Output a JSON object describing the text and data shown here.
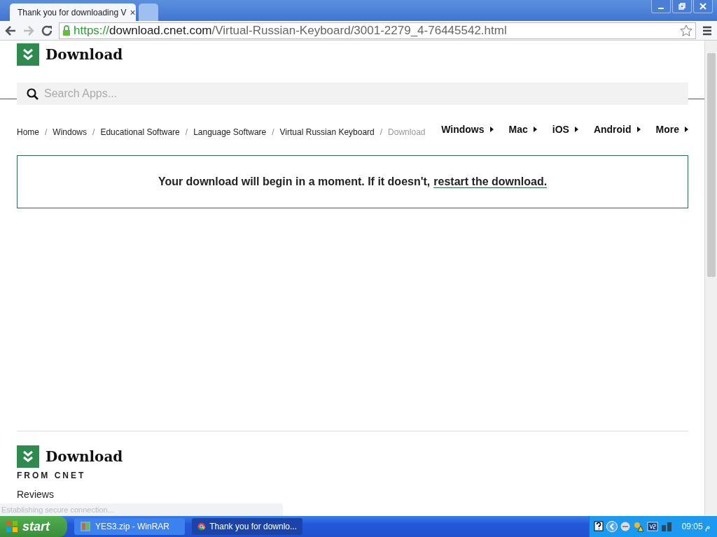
{
  "browser": {
    "tabs": [
      {
        "title": "Thank you for downloading V",
        "selected": true,
        "close": "×"
      },
      {
        "selected": false
      }
    ],
    "url": {
      "secure": "https://",
      "host": "download.cnet.com",
      "path": "/Virtual-Russian-Keyboard/3001-2279_4-76445542.html"
    }
  },
  "header": {
    "logo": "Download",
    "search_placeholder": "Search Apps..."
  },
  "breadcrumbs": [
    {
      "label": "Home",
      "current": false
    },
    {
      "label": "Windows",
      "current": false
    },
    {
      "label": "Educational Software",
      "current": false
    },
    {
      "label": "Language Software",
      "current": false
    },
    {
      "label": "Virtual Russian Keyboard",
      "current": false
    },
    {
      "label": "Download",
      "current": true
    }
  ],
  "breadcrumb_separator": "/",
  "nav": [
    "Windows",
    "Mac",
    "iOS",
    "Android",
    "More"
  ],
  "message": {
    "text": "Your download will begin in a moment. If it doesn't,",
    "link": "restart the download."
  },
  "footer": {
    "logo": "Download",
    "tagline": "FROM CNET",
    "links": [
      "Reviews"
    ]
  },
  "status_bar": "Establishing secure connection...",
  "taskbar": {
    "start": "start",
    "items": [
      {
        "label": "YES3.zip - WinRAR",
        "selected": false,
        "kind": "winrar"
      },
      {
        "label": "Thank you for downlo...",
        "selected": true,
        "kind": "browser"
      }
    ],
    "clock": "09:05 م"
  }
}
